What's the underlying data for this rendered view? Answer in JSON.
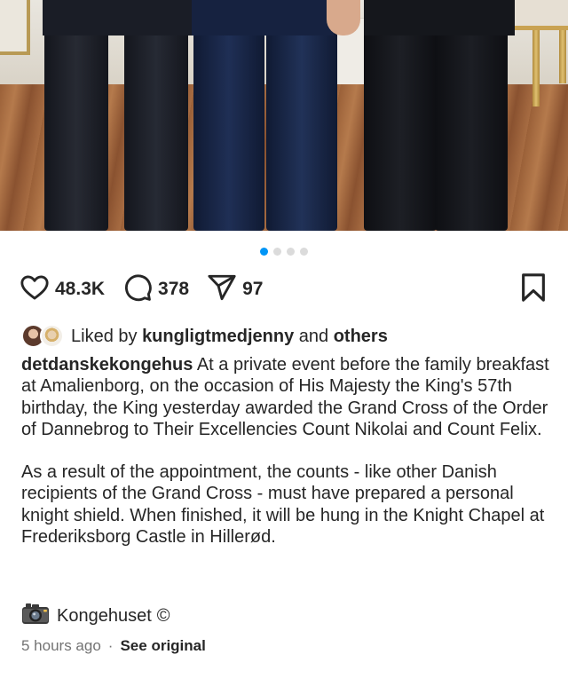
{
  "post": {
    "carousel": {
      "total_slides": 4,
      "active_index": 0
    },
    "actions": {
      "likes_count": "48.3K",
      "comments_count": "378",
      "shares_count": "97"
    },
    "likes": {
      "prefix": "Liked by",
      "liker": "kungligtmedjenny",
      "joiner": "and",
      "others": "others"
    },
    "caption": {
      "username": "detdanskekongehus",
      "paragraph1": "At a private event before the family breakfast at Amalienborg, on the occasion of His Majesty the King's 57th birthday, the King yesterday awarded the Grand Cross of the Order of Dannebrog to Their Excellencies Count Nikolai and Count Felix.",
      "paragraph2": "As a result of the appointment, the counts - like other Danish recipients of the Grand Cross - must have prepared a personal knight shield. When finished, it will be hung in the Knight Chapel at Frederiksborg Castle in Hillerød."
    },
    "translation": {
      "label": "Kongehuset",
      "symbol": "©"
    },
    "meta": {
      "time": "5 hours ago",
      "separator": "·",
      "see_original": "See original"
    }
  },
  "colors": {
    "accent": "#0095f6",
    "text": "#262626",
    "muted": "#737373"
  },
  "icons": [
    "heart-icon",
    "comment-icon",
    "share-icon",
    "bookmark-icon",
    "camera-icon"
  ]
}
